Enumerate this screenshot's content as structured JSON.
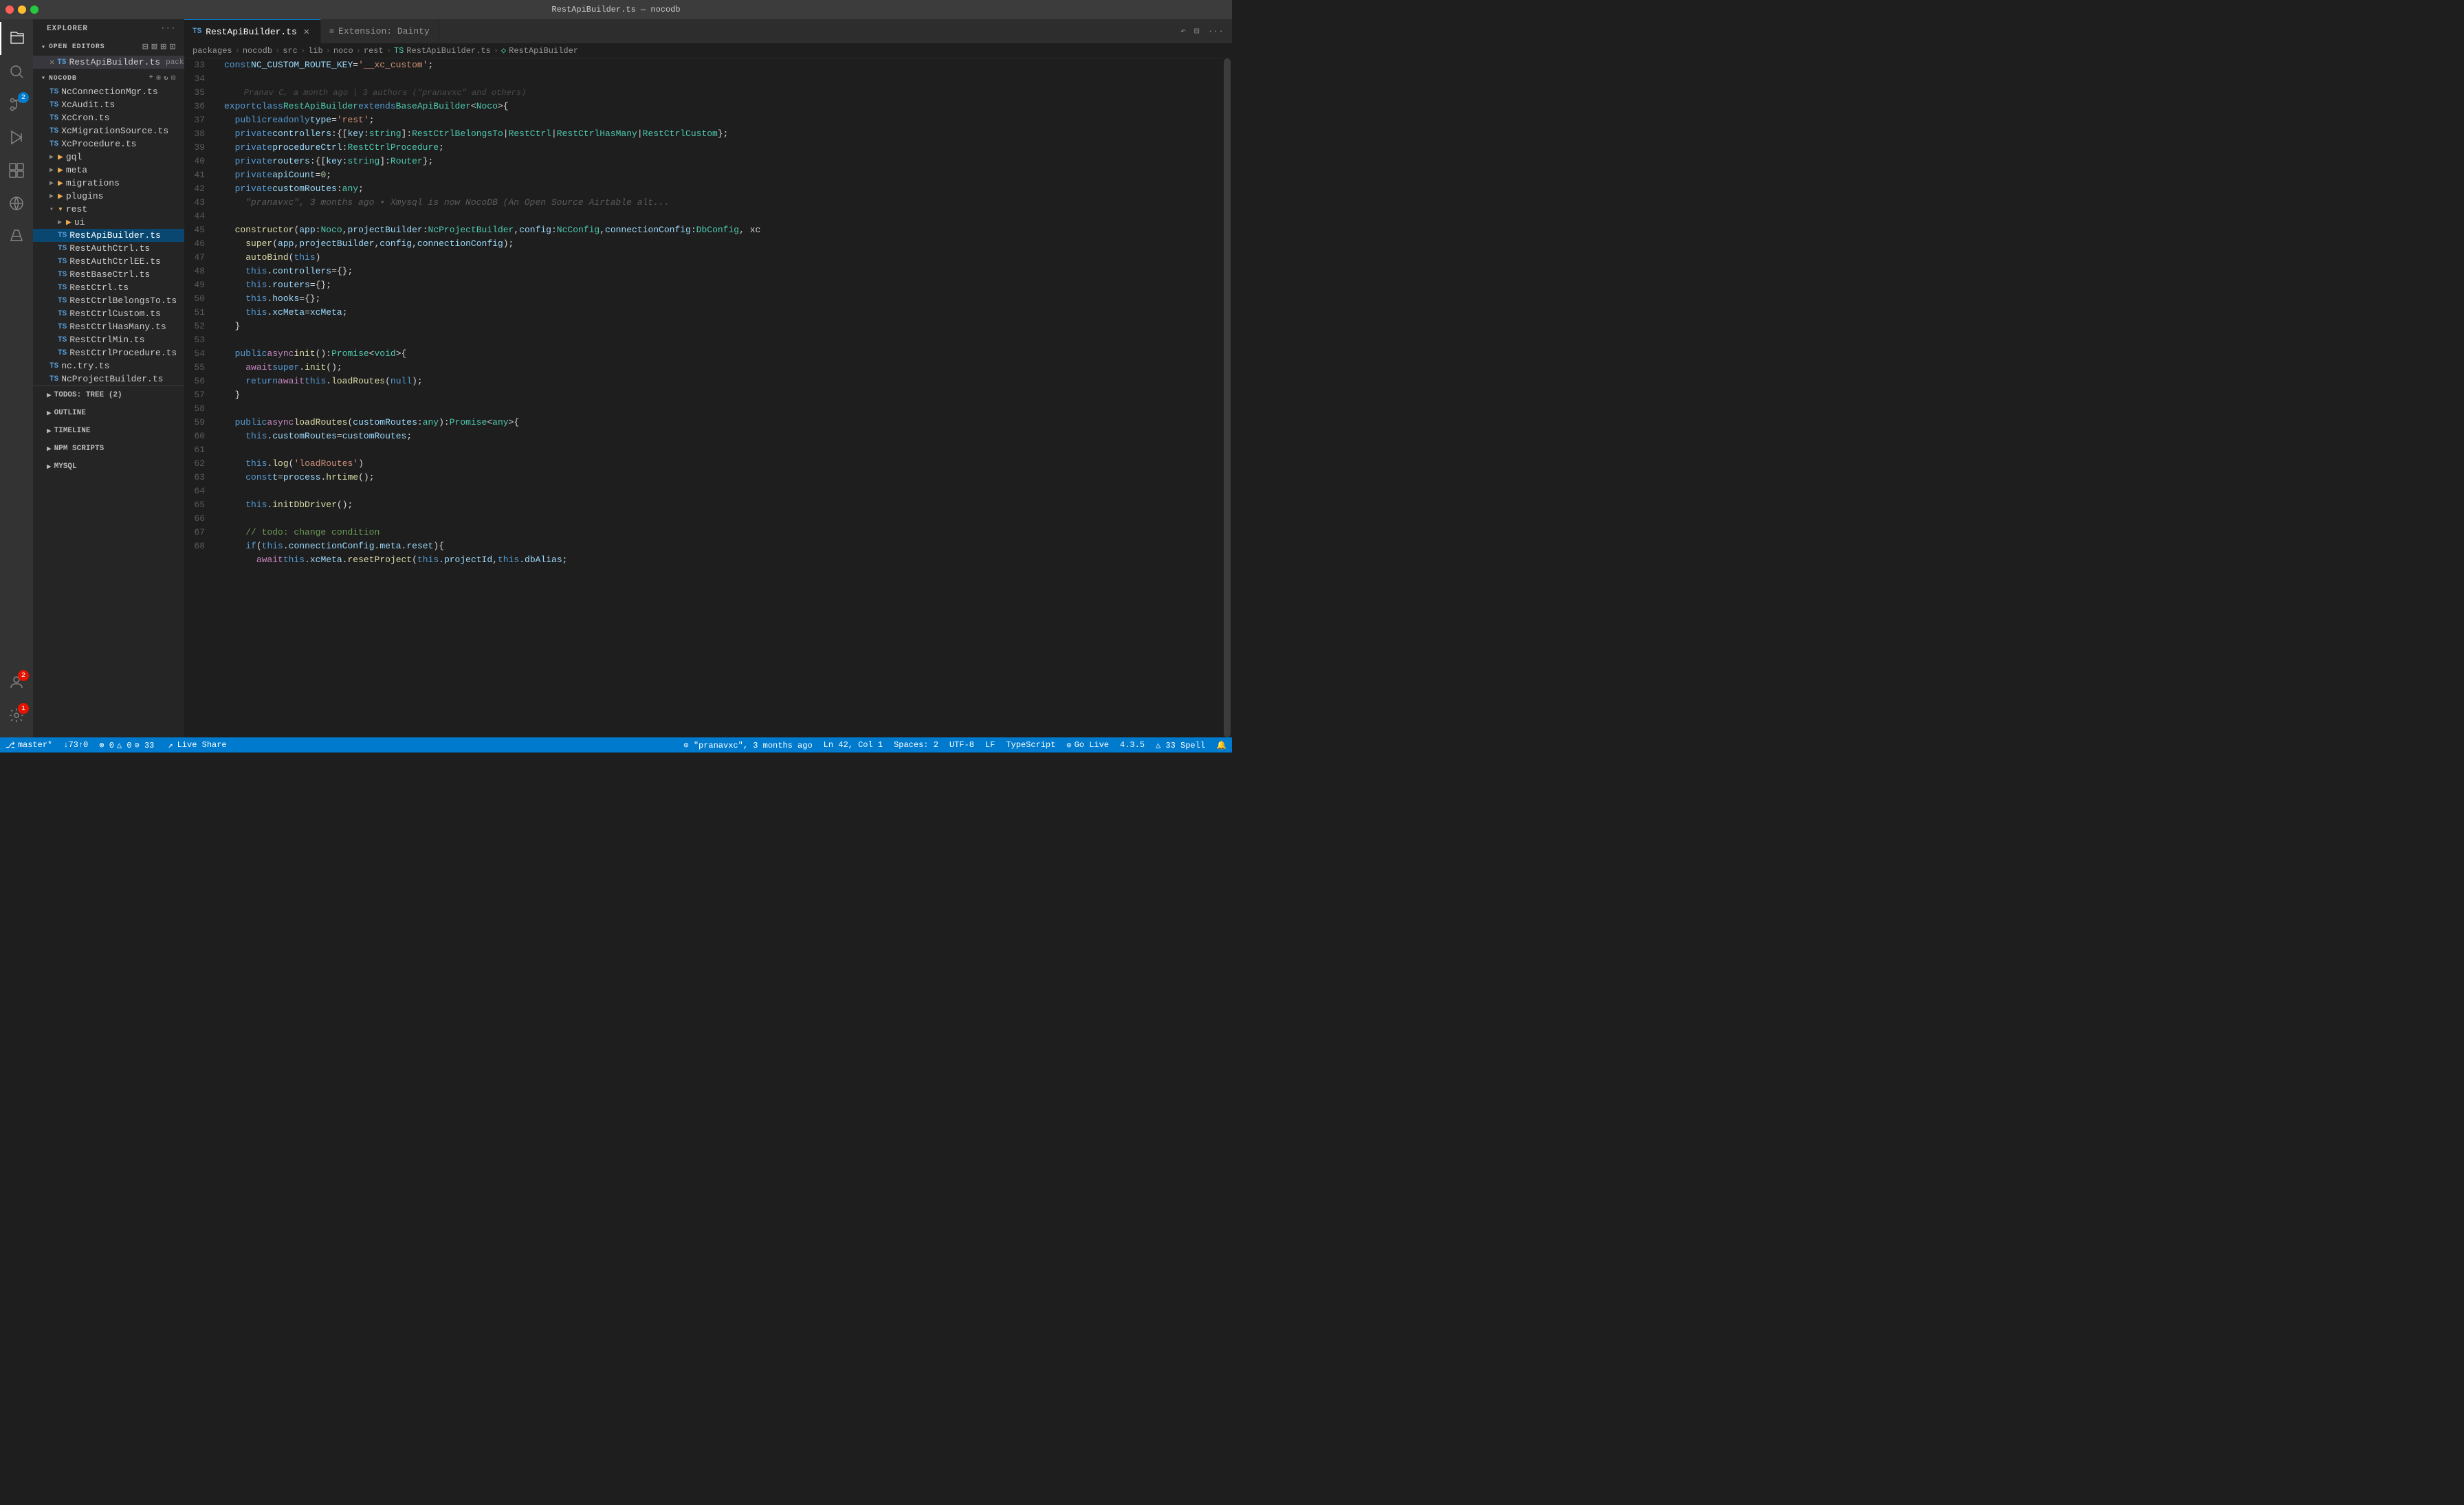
{
  "titleBar": {
    "title": "RestApiBuilder.ts — nocodb"
  },
  "activityBar": {
    "items": [
      {
        "id": "explorer",
        "icon": "files-icon",
        "active": true
      },
      {
        "id": "search",
        "icon": "search-icon",
        "active": false
      },
      {
        "id": "source-control",
        "icon": "source-control-icon",
        "active": false,
        "badge": "2"
      },
      {
        "id": "run",
        "icon": "run-icon",
        "active": false
      },
      {
        "id": "extensions",
        "icon": "extensions-icon",
        "active": false
      },
      {
        "id": "remote",
        "icon": "remote-icon",
        "active": false
      },
      {
        "id": "test",
        "icon": "test-icon",
        "active": false
      }
    ],
    "bottomItems": [
      {
        "id": "accounts",
        "icon": "accounts-icon",
        "badge": "2"
      },
      {
        "id": "settings",
        "icon": "settings-icon"
      }
    ]
  },
  "sidebar": {
    "title": "EXPLORER",
    "openEditors": {
      "label": "OPEN EDITORS",
      "files": [
        {
          "name": "RestApiBuilder.ts",
          "path": "packages/nocodb/src/lib/no...",
          "modified": true
        }
      ]
    },
    "nocodb": {
      "label": "NOCODB",
      "files": [
        {
          "name": "NcConnectionMgr.ts",
          "type": "ts",
          "indent": 1
        },
        {
          "name": "XcAudit.ts",
          "type": "ts",
          "indent": 1
        },
        {
          "name": "XcCron.ts",
          "type": "ts",
          "indent": 1
        },
        {
          "name": "XcMigrationSource.ts",
          "type": "ts",
          "indent": 1
        },
        {
          "name": "XcProcedure.ts",
          "type": "ts",
          "indent": 1
        },
        {
          "name": "gql",
          "type": "folder",
          "indent": 1
        },
        {
          "name": "meta",
          "type": "folder",
          "indent": 1
        },
        {
          "name": "migrations",
          "type": "folder",
          "indent": 1
        },
        {
          "name": "plugins",
          "type": "folder",
          "indent": 1
        },
        {
          "name": "rest",
          "type": "folder",
          "indent": 1,
          "expanded": true
        },
        {
          "name": "ui",
          "type": "folder",
          "indent": 2
        },
        {
          "name": "RestApiBuilder.ts",
          "type": "ts",
          "indent": 2,
          "active": true
        },
        {
          "name": "RestAuthCtrl.ts",
          "type": "ts",
          "indent": 2
        },
        {
          "name": "RestAuthCtrlEE.ts",
          "type": "ts",
          "indent": 2
        },
        {
          "name": "RestBaseCtrl.ts",
          "type": "ts",
          "indent": 2
        },
        {
          "name": "RestCtrl.ts",
          "type": "ts",
          "indent": 2
        },
        {
          "name": "RestCtrlBelongsTo.ts",
          "type": "ts",
          "indent": 2
        },
        {
          "name": "RestCtrlCustom.ts",
          "type": "ts",
          "indent": 2
        },
        {
          "name": "RestCtrlHasMany.ts",
          "type": "ts",
          "indent": 2
        },
        {
          "name": "RestCtrlMin.ts",
          "type": "ts",
          "indent": 2
        },
        {
          "name": "RestCtrlProcedure.ts",
          "type": "ts",
          "indent": 2
        },
        {
          "name": "nc.try.ts",
          "type": "ts",
          "indent": 1
        },
        {
          "name": "NcProjectBuilder.ts",
          "type": "ts",
          "indent": 1
        }
      ]
    },
    "subsections": [
      {
        "label": "TODOS: TREE (2)",
        "collapsed": true
      },
      {
        "label": "OUTLINE",
        "collapsed": true
      },
      {
        "label": "TIMELINE",
        "collapsed": true
      },
      {
        "label": "NPM SCRIPTS",
        "collapsed": true
      },
      {
        "label": "MYSQL",
        "collapsed": true
      }
    ]
  },
  "tabs": [
    {
      "id": "restapi",
      "label": "RestApiBuilder.ts",
      "active": true,
      "modified": false
    },
    {
      "id": "extension",
      "label": "Extension: Dainty",
      "active": false
    }
  ],
  "breadcrumb": {
    "items": [
      "packages",
      "nocodb",
      "src",
      "lib",
      "noco",
      "rest",
      "RestApiBuilder.ts",
      "RestApiBuilder"
    ]
  },
  "code": {
    "blameInfo": "Pranav C, a month ago | 3 authors (\"pranavxc\" and others)",
    "lines": [
      {
        "num": 33,
        "content": "const NC_CUSTOM_ROUTE_KEY = '__xc_custom';"
      },
      {
        "num": 34,
        "content": ""
      },
      {
        "num": 35,
        "content": "export class RestApiBuilder extends BaseApiBuilder<Noco> {"
      },
      {
        "num": 36,
        "content": "  public readonly type = 'rest';"
      },
      {
        "num": 37,
        "content": "  private controllers: { [key: string]: RestCtrlBelongsTo | RestCtrl | RestCtrlHasMany | RestCtrlCustom };"
      },
      {
        "num": 38,
        "content": "  private procedureCtrl: RestCtrlProcedure;"
      },
      {
        "num": 39,
        "content": "  private routers: { [key: string]: Router };"
      },
      {
        "num": 40,
        "content": "  private apiCount = 0;"
      },
      {
        "num": 41,
        "content": "  private customRoutes: any;"
      },
      {
        "num": 42,
        "content": "    \"pranavxc\", 3 months ago • Xmysql is now NocoDB (An Open Source Airtable alt..."
      },
      {
        "num": 43,
        "content": ""
      },
      {
        "num": 44,
        "content": "  constructor(app: Noco, projectBuilder: NcProjectBuilder, config: NcConfig, connectionConfig: DbConfig, xc"
      },
      {
        "num": 45,
        "content": "    super(app, projectBuilder, config, connectionConfig);"
      },
      {
        "num": 46,
        "content": "    autoBind(this)"
      },
      {
        "num": 47,
        "content": "    this.controllers = {};"
      },
      {
        "num": 48,
        "content": "    this.routers = {};"
      },
      {
        "num": 49,
        "content": "    this.hooks = {};"
      },
      {
        "num": 50,
        "content": "    this.xcMeta = xcMeta;"
      },
      {
        "num": 51,
        "content": "  }"
      },
      {
        "num": 52,
        "content": ""
      },
      {
        "num": 53,
        "content": "  public async init(): Promise<void> {"
      },
      {
        "num": 54,
        "content": "    await super.init();"
      },
      {
        "num": 55,
        "content": "    return await this.loadRoutes(null);"
      },
      {
        "num": 56,
        "content": "  }"
      },
      {
        "num": 57,
        "content": ""
      },
      {
        "num": 58,
        "content": "  public async loadRoutes(customRoutes: any): Promise<any> {"
      },
      {
        "num": 59,
        "content": "    this.customRoutes = customRoutes;"
      },
      {
        "num": 60,
        "content": ""
      },
      {
        "num": 61,
        "content": "    this.log('loadRoutes')"
      },
      {
        "num": 62,
        "content": "    const t = process.hrtime();"
      },
      {
        "num": 63,
        "content": ""
      },
      {
        "num": 64,
        "content": "    this.initDbDriver();"
      },
      {
        "num": 65,
        "content": ""
      },
      {
        "num": 66,
        "content": "    // todo: change condition"
      },
      {
        "num": 67,
        "content": "    if (this.connectionConfig.meta.reset) {"
      },
      {
        "num": 68,
        "content": "      await this.xcMeta.resetProject(this.projectId, this.dbAlias;"
      }
    ]
  },
  "statusBar": {
    "left": [
      {
        "id": "branch",
        "icon": "git-branch-icon",
        "text": " master*"
      },
      {
        "id": "sync",
        "icon": "sync-icon",
        "text": "↓73↑0"
      },
      {
        "id": "errors",
        "icon": "error-icon",
        "text": "⊗ 0  △ 0  ⊙ 33"
      }
    ],
    "liveShare": "Live Share",
    "right": [
      {
        "id": "blame",
        "text": "\"pranavxc\", 3 months ago"
      },
      {
        "id": "position",
        "text": "Ln 42, Col 1"
      },
      {
        "id": "spaces",
        "text": "Spaces: 2"
      },
      {
        "id": "encoding",
        "text": "UTF-8"
      },
      {
        "id": "eol",
        "text": "LF"
      },
      {
        "id": "language",
        "text": "TypeScript"
      },
      {
        "id": "golive",
        "text": "⊙ Go Live"
      },
      {
        "id": "version",
        "text": "4.3.5"
      },
      {
        "id": "spell",
        "text": "△ 33 Spell"
      }
    ]
  }
}
